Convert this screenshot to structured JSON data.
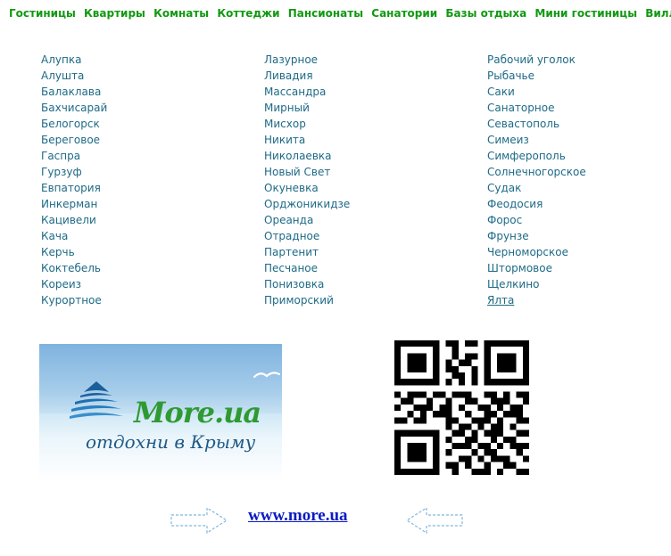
{
  "nav": {
    "items": [
      "Гостиницы",
      "Квартиры",
      "Комнаты",
      "Коттеджи",
      "Пансионаты",
      "Санатории",
      "Базы отдыха",
      "Мини гостиницы",
      "Виллы"
    ]
  },
  "cities": {
    "col1": [
      "Алупка",
      "Алушта",
      "Балаклава",
      "Бахчисарай",
      "Белогорск",
      "Береговое",
      "Гаспра",
      "Гурзуф",
      "Евпатория",
      "Инкерман",
      "Кацивели",
      "Кача",
      "Керчь",
      "Коктебель",
      "Кореиз",
      "Курортное"
    ],
    "col2": [
      "Лазурное",
      "Ливадия",
      "Массандра",
      "Мирный",
      "Мисхор",
      "Никита",
      "Николаевка",
      "Новый Свет",
      "Окуневка",
      "Орджоникидзе",
      "Ореанда",
      "Отрадное",
      "Партенит",
      "Песчаное",
      "Понизовка",
      "Приморский"
    ],
    "col3": [
      "Рабочий уголок",
      "Рыбачье",
      "Саки",
      "Санаторное",
      "Севастополь",
      "Симеиз",
      "Симферополь",
      "Солнечногорское",
      "Судак",
      "Феодосия",
      "Форос",
      "Фрунзе",
      "Черноморское",
      "Штормовое",
      "Щелкино",
      "Ялта"
    ]
  },
  "banner": {
    "brand": "More.ua",
    "tagline": "отдохни в Крыму"
  },
  "site_link": "www.more.ua",
  "colors": {
    "nav": "#119911",
    "city_link": "#1e6a86",
    "site_link": "#0b1cc2"
  }
}
